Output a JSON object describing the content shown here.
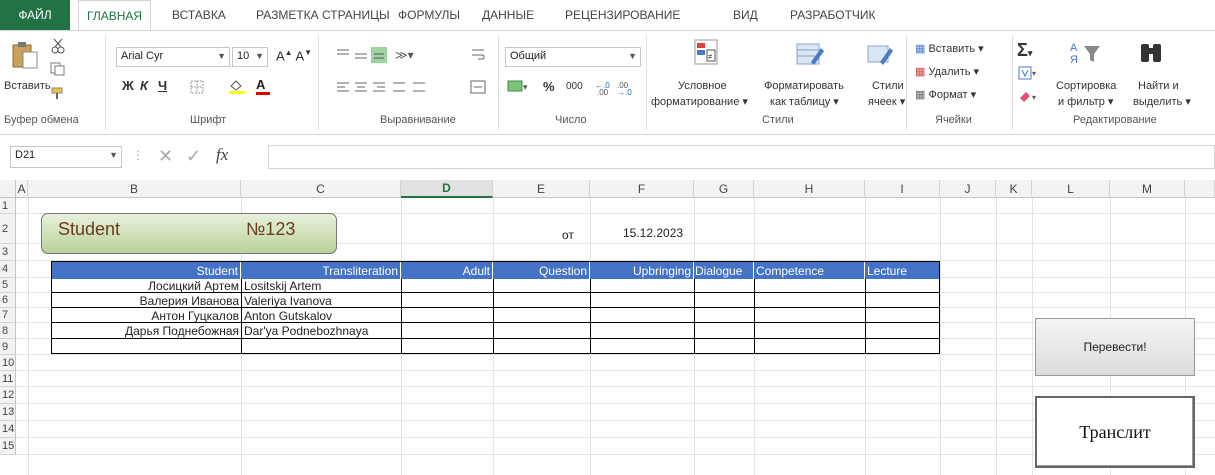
{
  "ribbon": {
    "tabs": [
      "ФАЙЛ",
      "ГЛАВНАЯ",
      "ВСТАВКА",
      "РАЗМЕТКА СТРАНИЦЫ",
      "ФОРМУЛЫ",
      "ДАННЫЕ",
      "РЕЦЕНЗИРОВАНИЕ",
      "ВИД",
      "РАЗРАБОТЧИК"
    ],
    "clipboard": {
      "paste": "Вставить",
      "label": "Буфер обмена"
    },
    "font": {
      "name": "Arial Cyr",
      "size": "10",
      "bold": "Ж",
      "italic": "К",
      "underline": "Ч",
      "label": "Шрифт"
    },
    "alignment": {
      "label": "Выравнивание"
    },
    "number": {
      "format": "Общий",
      "percent": "%",
      "thousands": "000",
      "label": "Число"
    },
    "styles": {
      "conditional": "Условное",
      "conditional2": "форматирование",
      "as_table": "Форматировать",
      "as_table2": "как таблицу",
      "cell_styles": "Стили",
      "cell_styles2": "ячеек",
      "label": "Стили"
    },
    "cells": {
      "insert": "Вставить",
      "delete": "Удалить",
      "format": "Формат",
      "label": "Ячейки"
    },
    "editing": {
      "sort": "Сортировка",
      "sort2": "и фильтр",
      "find": "Найти и",
      "find2": "выделить",
      "label": "Редактирование"
    }
  },
  "formula_bar": {
    "name_box": "D21",
    "fx": "fx",
    "formula": ""
  },
  "columns": [
    "A",
    "B",
    "C",
    "D",
    "E",
    "F",
    "G",
    "H",
    "I",
    "J",
    "K",
    "L",
    "M"
  ],
  "rows": [
    "1",
    "2",
    "3",
    "4",
    "5",
    "6",
    "7",
    "8",
    "9",
    "10",
    "11",
    "12",
    "13",
    "14",
    "15"
  ],
  "sheet": {
    "shape_title": "Student",
    "shape_number": "№123",
    "from_label": "от",
    "date": "15.12.2023",
    "table_headers": [
      "Student",
      "Transliteration",
      "Adult",
      "Question",
      "Upbringing",
      "Dialogue",
      "Competence",
      "Lecture"
    ],
    "table_rows": [
      [
        "Лосицкий Артем",
        "Lositskij Artem"
      ],
      [
        "Валерия Иванова",
        "Valeriya Ivanova"
      ],
      [
        "Антон Гуцкалов",
        "Anton Gutskalov"
      ],
      [
        "Дарья Поднебожная",
        "Dar'ya Podnebozhnaya"
      ]
    ],
    "btn_translate": "Перевести!",
    "btn_translit": "Транслит"
  }
}
